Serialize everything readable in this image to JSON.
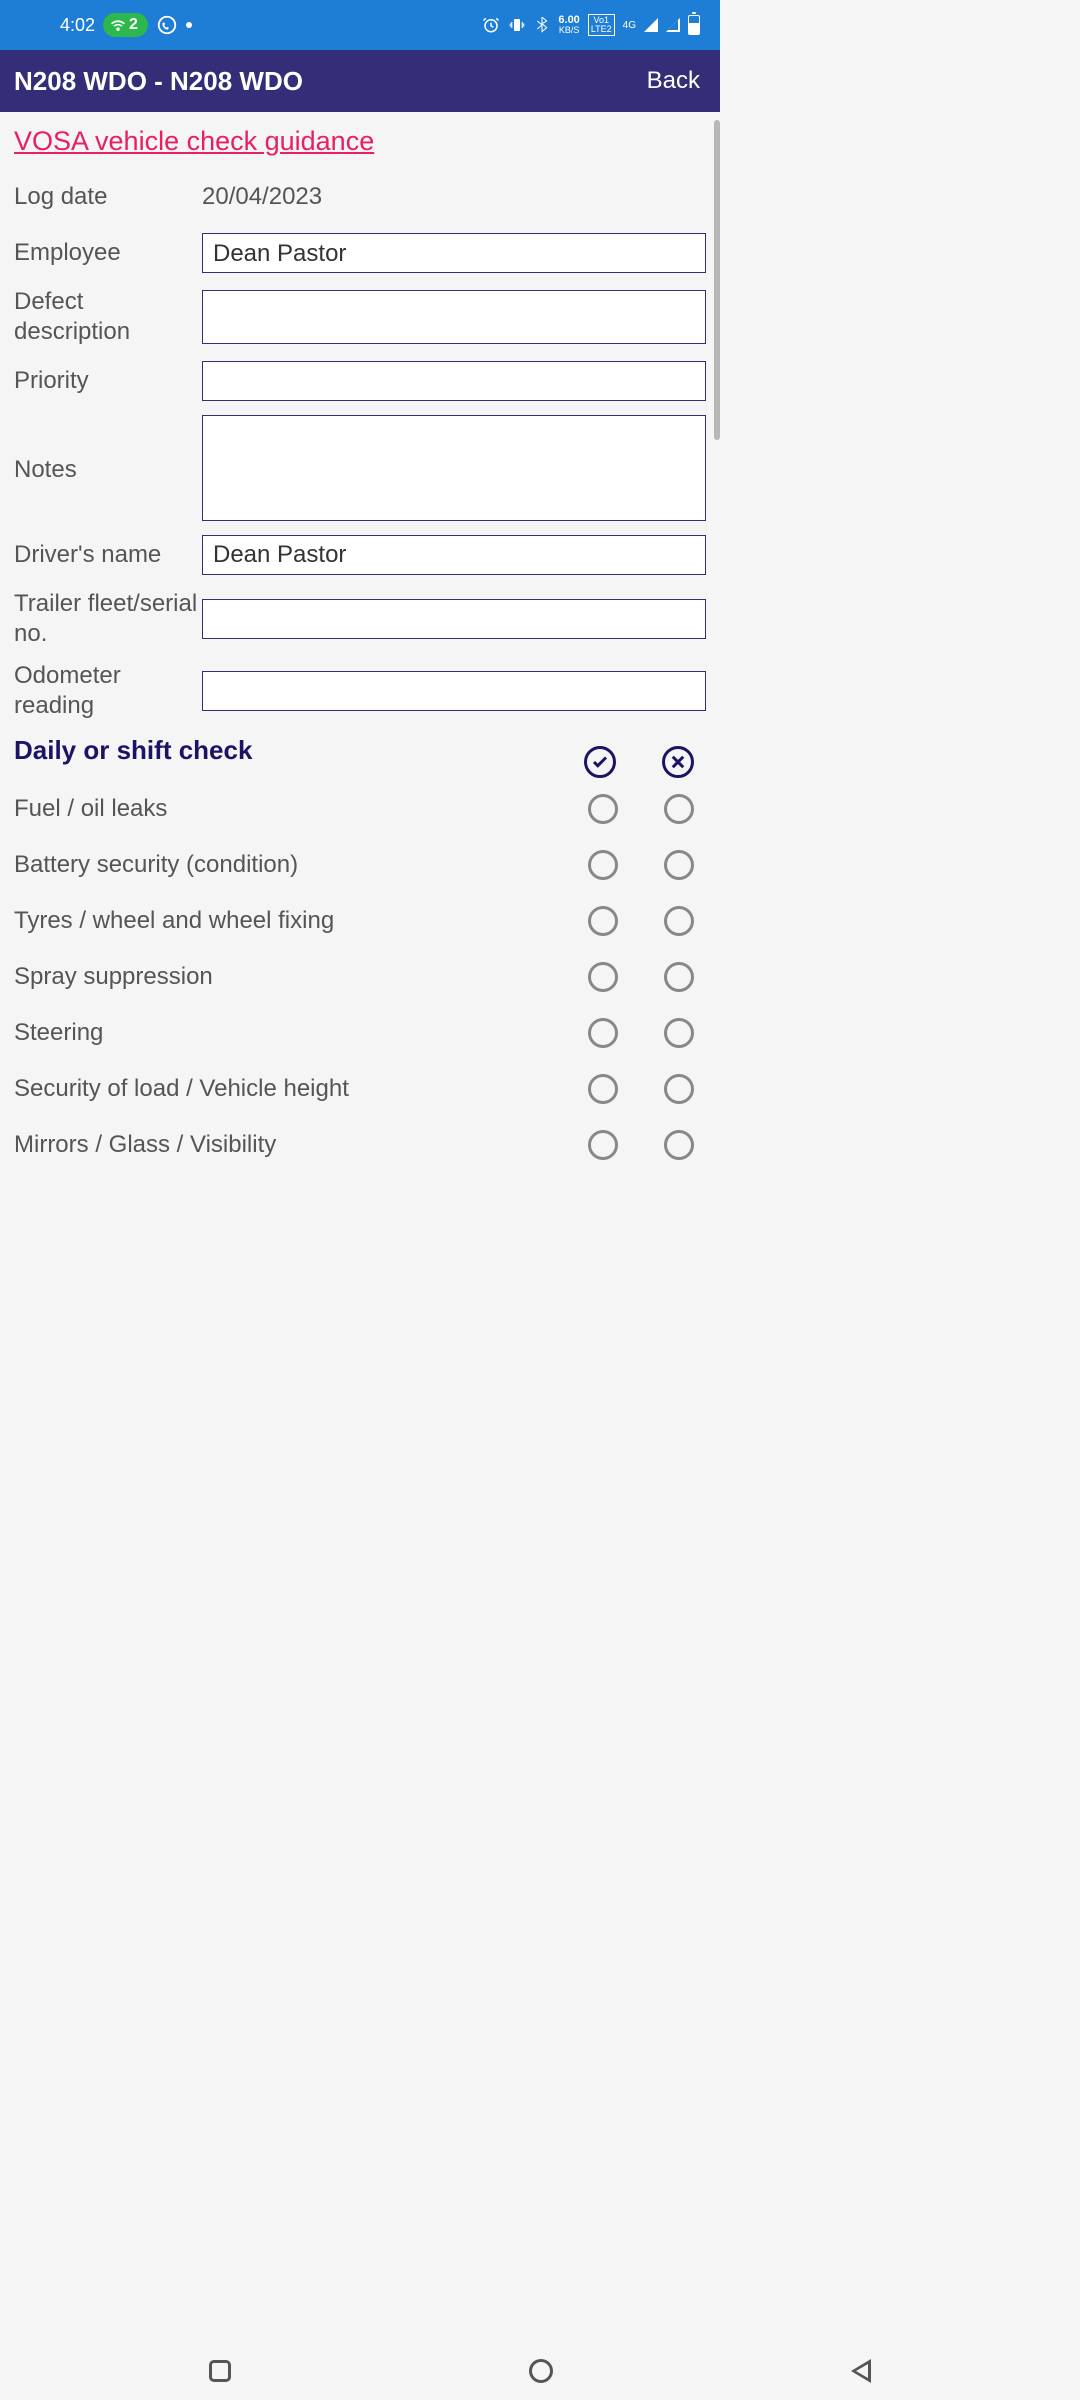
{
  "status": {
    "time": "4:02",
    "wifi_count": "2",
    "kbs": "6.00",
    "kbs_label": "KB/S",
    "lte_top": "Vo1",
    "lte_bottom": "LTE2",
    "network": "4G"
  },
  "header": {
    "title": "N208 WDO - N208 WDO",
    "back": "Back"
  },
  "link": "VOSA vehicle check guidance",
  "form": {
    "log_date_label": "Log date",
    "log_date_value": "20/04/2023",
    "employee_label": "Employee",
    "employee_value": "Dean Pastor",
    "defect_label": "Defect description",
    "defect_value": "",
    "priority_label": "Priority",
    "priority_value": "",
    "notes_label": "Notes",
    "notes_value": "",
    "driver_label": "Driver's name",
    "driver_value": "Dean Pastor",
    "trailer_label": "Trailer fleet/serial no.",
    "trailer_value": "",
    "odometer_label": "Odometer reading",
    "odometer_value": ""
  },
  "section_title": "Daily or shift check",
  "checks": [
    "Fuel / oil leaks",
    "Battery security (condition)",
    "Tyres / wheel and wheel fixing",
    "Spray suppression",
    "Steering",
    "Security of load / Vehicle height",
    "Mirrors / Glass / Visibility"
  ]
}
